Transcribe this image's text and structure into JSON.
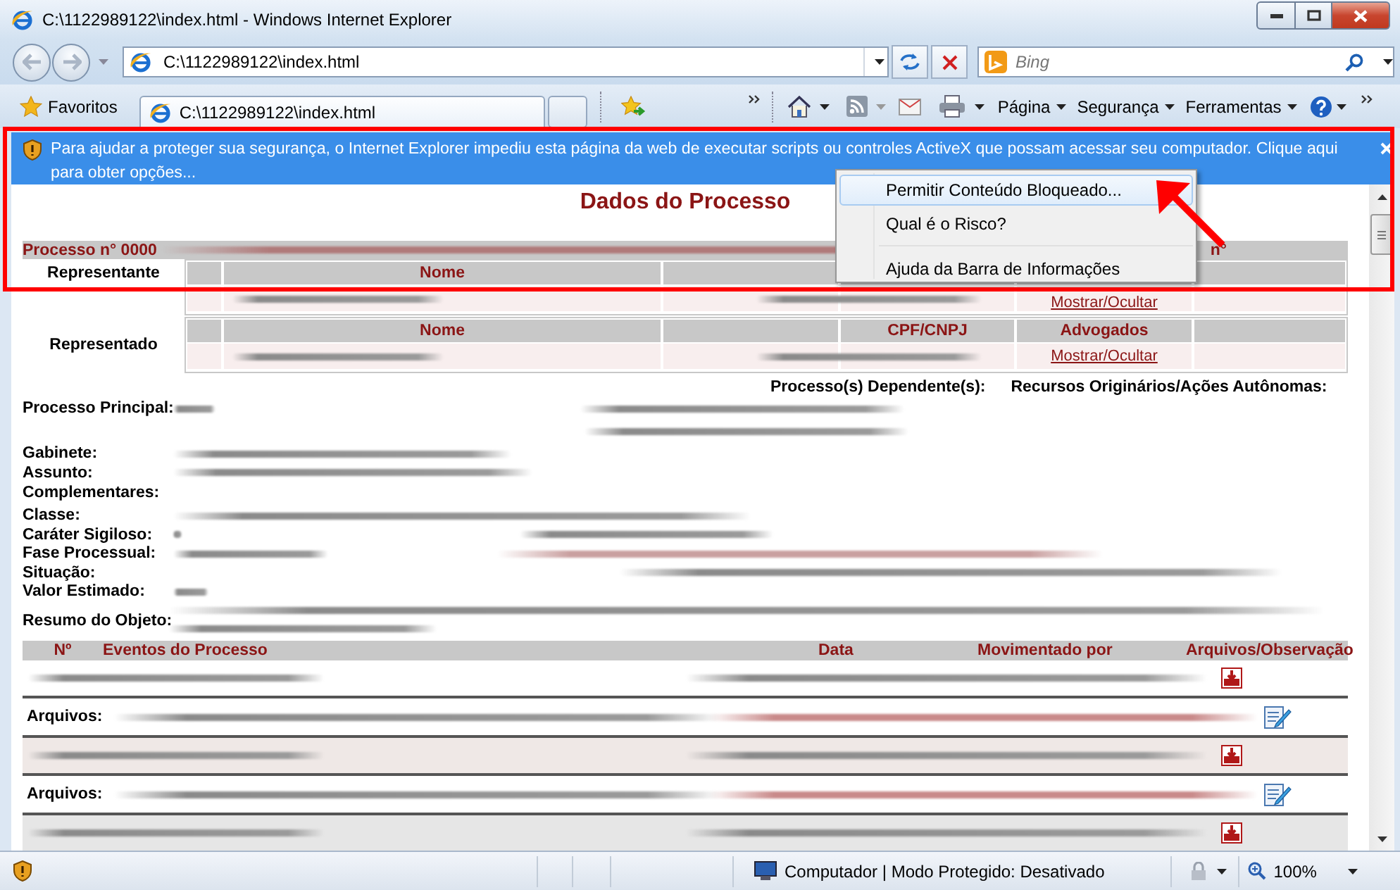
{
  "window": {
    "title": "C:\\1122989122\\index.html - Windows Internet Explorer"
  },
  "address_bar": {
    "value": "C:\\1122989122\\index.html"
  },
  "search": {
    "placeholder": "Bing"
  },
  "favorites_button": "Favoritos",
  "tabs": [
    {
      "label": "C:\\1122989122\\index.html",
      "selected": true
    }
  ],
  "command_bar": [
    {
      "label": "Página"
    },
    {
      "label": "Segurança"
    },
    {
      "label": "Ferramentas"
    }
  ],
  "info_bar": {
    "message": "Para ajudar a proteger sua segurança, o Internet Explorer impediu esta página da web de executar scripts ou controles ActiveX que possam acessar seu computador. Clique aqui para obter opções..."
  },
  "context_menu": {
    "items": [
      {
        "label": "Permitir Conteúdo Bloqueado...",
        "selected": true
      },
      {
        "label": "Qual é o Risco?",
        "selected": false
      },
      {
        "label": "Ajuda da Barra de Informações",
        "selected": false
      }
    ]
  },
  "page": {
    "title": "Dados do Processo",
    "process_number": "Processo n° 0000",
    "process_number_tail": "n°",
    "parties": [
      {
        "role": "Representante",
        "columns": {
          "name": "Nome"
        },
        "link": "Mostrar/Ocultar"
      },
      {
        "role": "Representado",
        "columns": {
          "name": "Nome",
          "document": "CPF/CNPJ",
          "lawyers": "Advogados"
        },
        "link": "Mostrar/Ocultar"
      }
    ],
    "dependents_label": "Processo(s) Dependente(s):",
    "origins_label": "Recursos Originários/Ações Autônomas:",
    "main_process_label": "Processo Principal:",
    "fields": [
      {
        "label": "Gabinete:"
      },
      {
        "label": "Assunto:"
      },
      {
        "label": "Complementares:"
      },
      {
        "label": "Classe:"
      },
      {
        "label": "Caráter Sigiloso:"
      },
      {
        "label": "Fase Processual:"
      },
      {
        "label": "Situação:"
      },
      {
        "label": "Valor Estimado:"
      }
    ],
    "summary_label": "Resumo do Objeto:",
    "events": {
      "columns": [
        "Nº",
        "Eventos do Processo",
        "Data",
        "Movimentado por",
        "Arquivos/Observação"
      ],
      "rows": [
        {
          "kind": "event"
        },
        {
          "kind": "files",
          "label": "Arquivos:"
        },
        {
          "kind": "event"
        },
        {
          "kind": "files",
          "label": "Arquivos:"
        },
        {
          "kind": "event"
        }
      ]
    }
  },
  "status_bar": {
    "zone": "Computador | Modo Protegido: Desativado",
    "zoom": "100%"
  }
}
